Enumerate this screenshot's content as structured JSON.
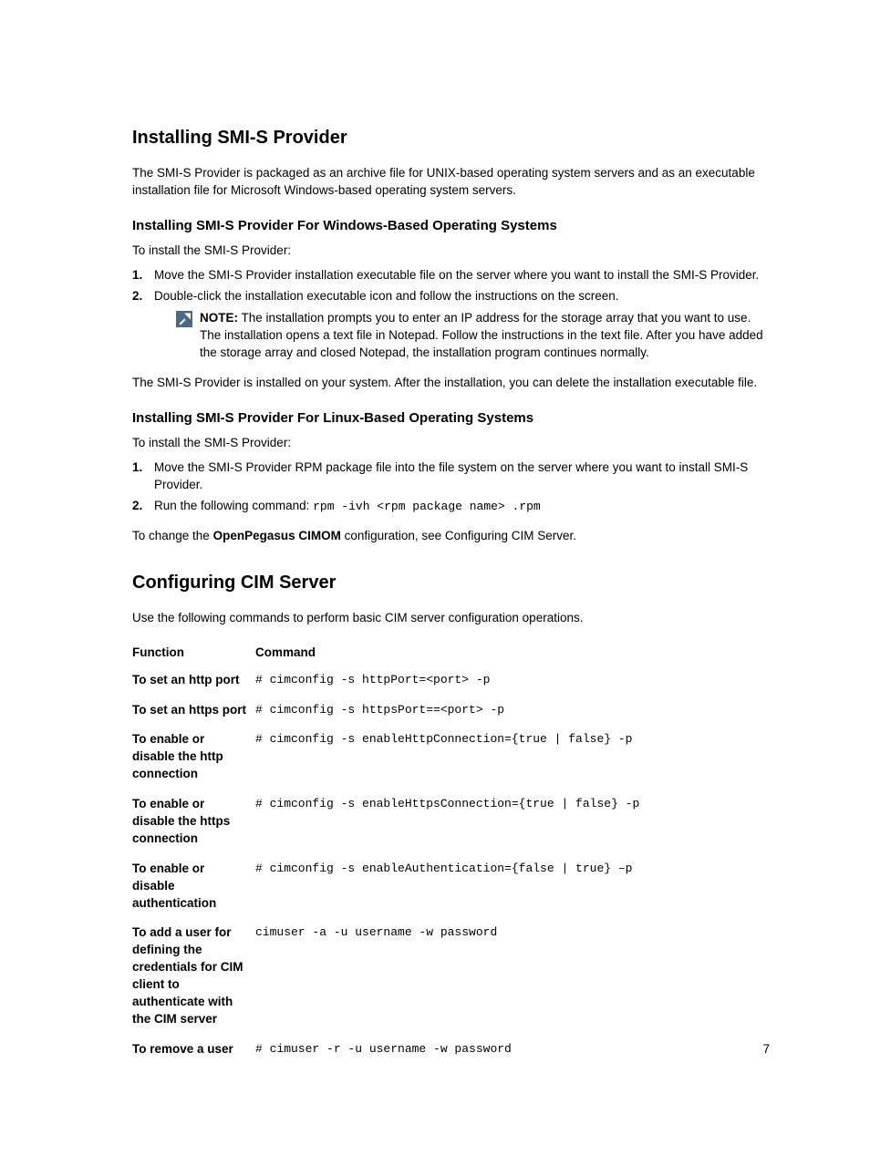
{
  "heading1": "Installing SMI-S Provider",
  "intro": "The SMI-S Provider is packaged as an archive file for UNIX-based operating system servers and as an executable installation file for Microsoft Windows-based operating system servers.",
  "sectionWin": {
    "heading": "Installing SMI-S Provider For Windows-Based Operating Systems",
    "intro": "To install the SMI-S Provider:",
    "step1": "Move the SMI-S Provider installation executable file on the server where you want to install the SMI-S Provider.",
    "step2": "Double-click the installation executable icon and follow the instructions on the screen.",
    "noteLabel": "NOTE:",
    "noteText": " The installation prompts you to enter an IP address for the storage array that you want to use. The installation opens a text file in Notepad. Follow the instructions in the text file. After you have added the storage array and closed Notepad, the installation program continues normally.",
    "closing": "The SMI-S Provider is installed on your system. After the installation, you can delete the installation executable file."
  },
  "sectionLinux": {
    "heading": "Installing SMI-S Provider For Linux-Based Operating Systems",
    "intro": "To install the SMI-S Provider:",
    "step1": "Move the SMI-S Provider RPM package file into the file system on the server where you want to install SMI-S Provider.",
    "step2a": "Run the following command: ",
    "step2b": "rpm -ivh <rpm package name> .rpm",
    "closingA": "To change the ",
    "closingB": "OpenPegasus CIMOM",
    "closingC": " configuration, see Configuring CIM Server."
  },
  "sectionCim": {
    "heading": "Configuring CIM Server",
    "intro": "Use the following commands to perform basic CIM server configuration operations.",
    "th1": "Function",
    "th2": "Command",
    "rows": [
      {
        "func": "To set an http port",
        "cmd": "# cimconfig -s httpPort=<port> -p"
      },
      {
        "func": "To set an https port",
        "cmd": "# cimconfig -s httpsPort==<port> -p"
      },
      {
        "func": "To enable or disable the http connection",
        "cmd": "# cimconfig -s enableHttpConnection={true | false} -p"
      },
      {
        "func": "To enable or disable the https connection",
        "cmd": "# cimconfig -s enableHttpsConnection={true | false} -p"
      },
      {
        "func": "To enable or disable authentication",
        "cmd": "# cimconfig -s enableAuthentication={false | true} –p"
      },
      {
        "func": "To add a user for defining the credentials for CIM client to authenticate with the CIM server",
        "cmd": "cimuser -a -u username -w password"
      },
      {
        "func": "To remove a user",
        "cmd": "# cimuser -r -u username -w password"
      }
    ]
  },
  "pageNumber": "7"
}
